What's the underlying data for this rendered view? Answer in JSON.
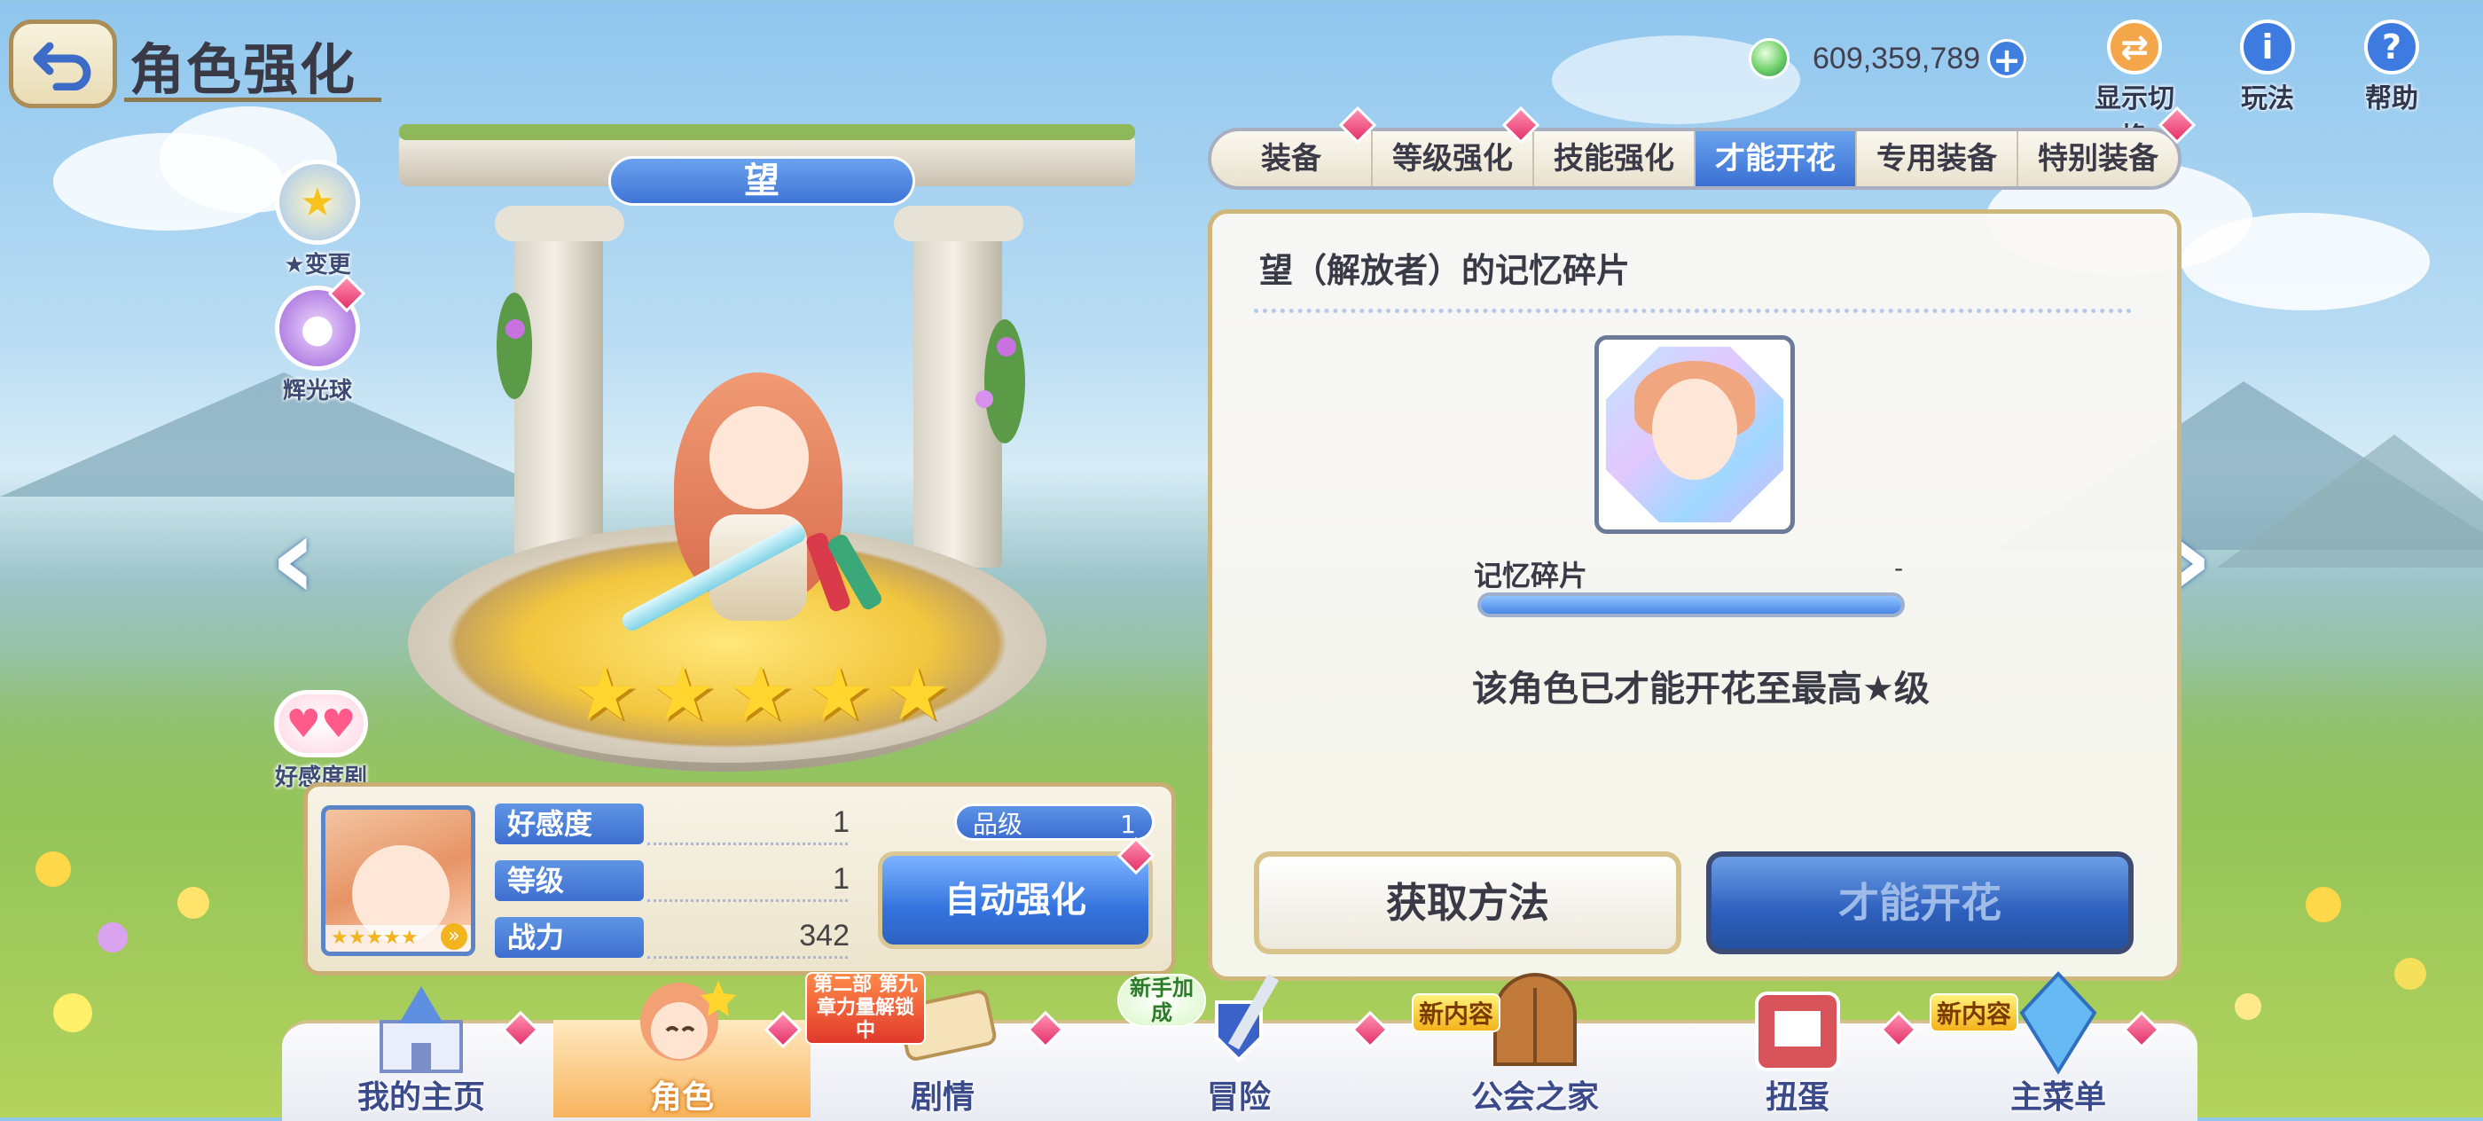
{
  "header": {
    "title": "角色强化",
    "gem_count": "609,359,789",
    "tools": [
      {
        "label": "显示切换",
        "icon": "display-toggle-icon"
      },
      {
        "label": "玩法",
        "icon": "info-icon"
      },
      {
        "label": "帮助",
        "icon": "help-icon"
      }
    ]
  },
  "side": {
    "star_change": "★变更",
    "glow_orb": "辉光球",
    "affection_story": "好感度剧情"
  },
  "character": {
    "name": "望",
    "stars": 5
  },
  "info": {
    "stats": [
      {
        "label": "好感度",
        "value": "1"
      },
      {
        "label": "等级",
        "value": "1"
      },
      {
        "label": "战力",
        "value": "342"
      }
    ],
    "rank_label": "品级",
    "rank_value": "1",
    "auto_button": "自动强化"
  },
  "tabs": [
    {
      "label": "装备",
      "active": false,
      "badge": true
    },
    {
      "label": "等级强化",
      "active": false,
      "badge": true
    },
    {
      "label": "技能强化",
      "active": false,
      "badge": false
    },
    {
      "label": "才能开花",
      "active": true,
      "badge": false
    },
    {
      "label": "专用装备",
      "active": false,
      "badge": false
    },
    {
      "label": "特别装备",
      "active": false,
      "badge": true
    }
  ],
  "panel": {
    "title": "望（解放者）的记忆碎片",
    "memory_label": "记忆碎片",
    "memory_count": "-",
    "memory_progress": 1.0,
    "max_message": "该角色已才能开花至最高★级",
    "get_button": "获取方法",
    "bloom_button": "才能开花"
  },
  "nav": {
    "items": [
      {
        "label": "我的主页",
        "active": false
      },
      {
        "label": "角色",
        "active": true
      },
      {
        "label": "剧情",
        "active": false
      },
      {
        "label": "冒险",
        "active": false
      },
      {
        "label": "公会之家",
        "active": false
      },
      {
        "label": "扭蛋",
        "active": false
      },
      {
        "label": "主菜单",
        "active": false
      }
    ],
    "story_tag": "第二部 第九章力量解锁中",
    "novice_tag": "新手加成",
    "new_content_tag": "新内容"
  },
  "colors": {
    "accent_blue": "#3f74d6",
    "gold_border": "#cfb67a",
    "badge_pink": "#e3326a"
  }
}
